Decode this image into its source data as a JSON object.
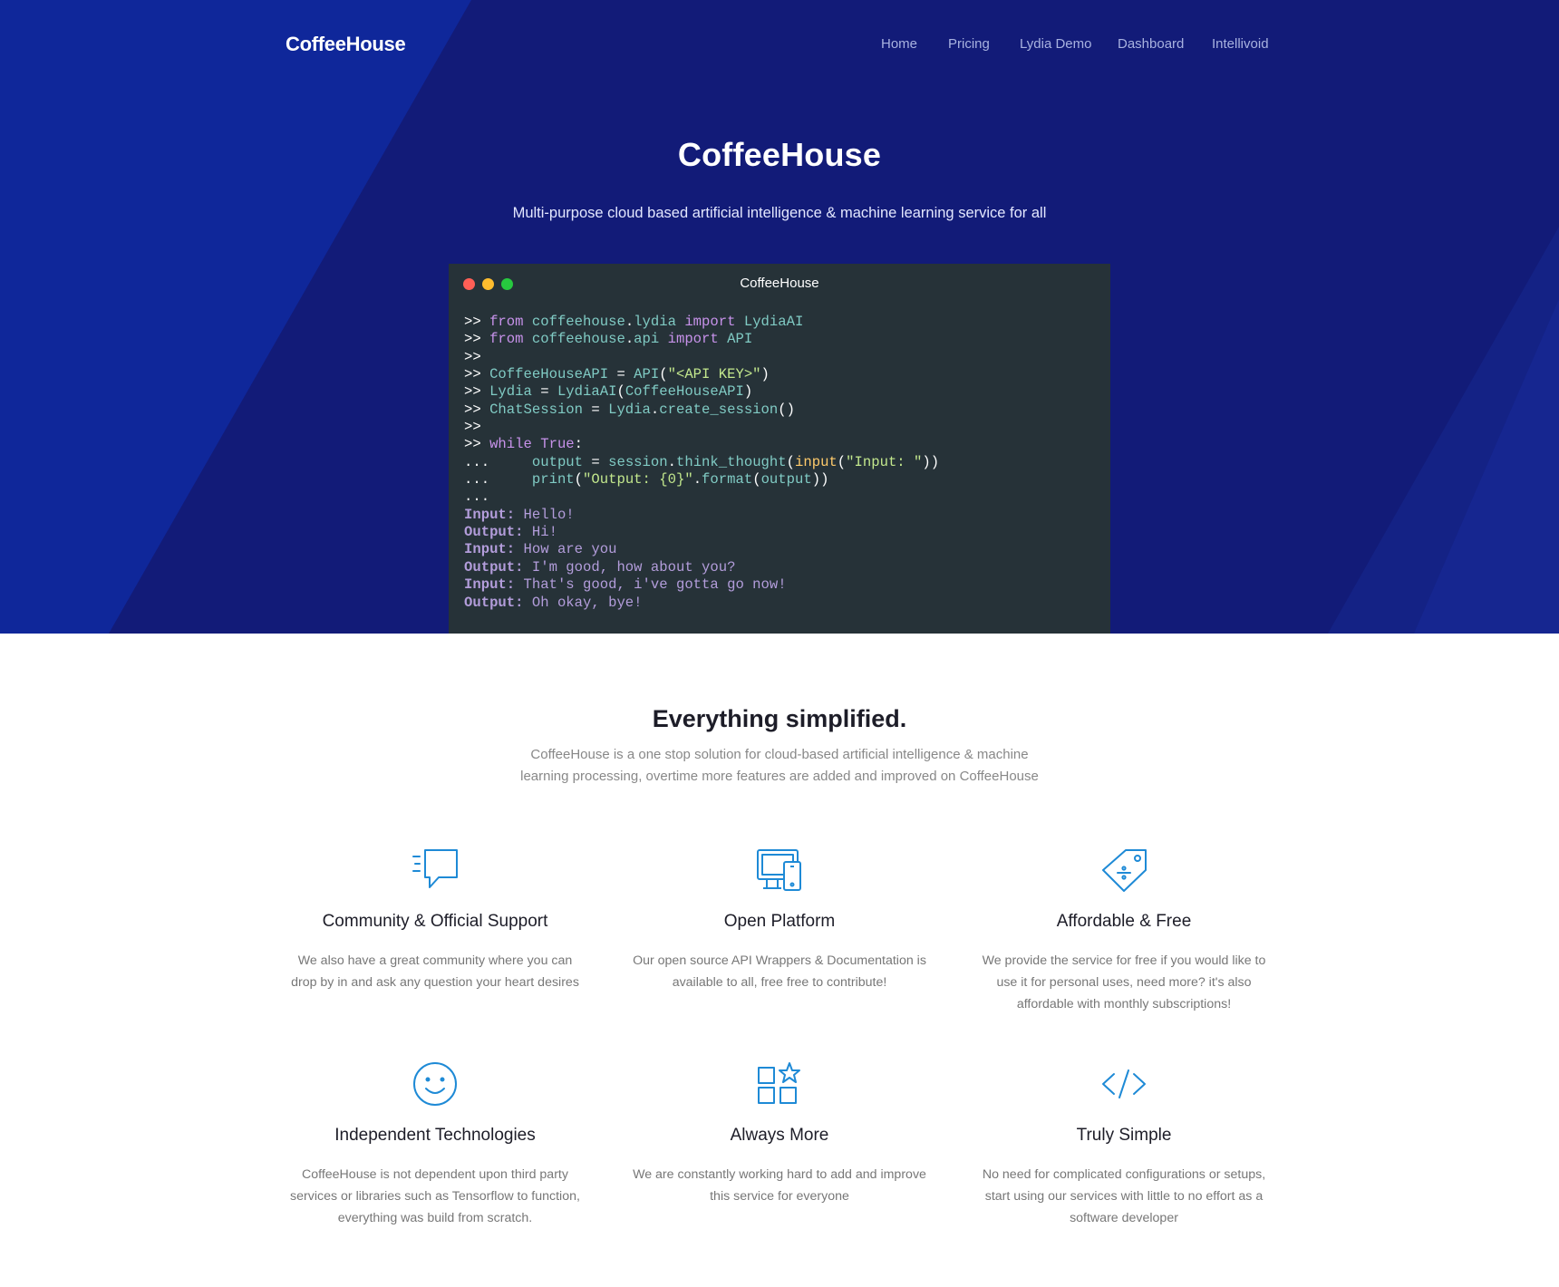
{
  "nav": {
    "brand": "CoffeeHouse",
    "links": [
      "Home",
      "Pricing",
      "Lydia Demo",
      "Dashboard",
      "Intellivoid"
    ]
  },
  "hero": {
    "title": "CoffeeHouse",
    "subtitle": "Multi-purpose cloud based artificial intelligence & machine learning service for all"
  },
  "terminal": {
    "title": "CoffeeHouse",
    "lines": [
      [
        [
          "p",
          ">> "
        ],
        [
          "kw",
          "from "
        ],
        [
          "id",
          "coffeehouse"
        ],
        [
          "p",
          "."
        ],
        [
          "id",
          "lydia "
        ],
        [
          "kw",
          "import "
        ],
        [
          "id",
          "LydiaAI"
        ]
      ],
      [
        [
          "p",
          ">> "
        ],
        [
          "kw",
          "from "
        ],
        [
          "id",
          "coffeehouse"
        ],
        [
          "p",
          "."
        ],
        [
          "id",
          "api "
        ],
        [
          "kw",
          "import "
        ],
        [
          "id",
          "API"
        ]
      ],
      [
        [
          "p",
          ">>"
        ]
      ],
      [
        [
          "p",
          ">> "
        ],
        [
          "id",
          "CoffeeHouseAPI "
        ],
        [
          "p",
          "= "
        ],
        [
          "id",
          "API"
        ],
        [
          "p",
          "("
        ],
        [
          "st",
          "\"<API KEY>\""
        ],
        [
          "p",
          ")"
        ]
      ],
      [
        [
          "p",
          ">> "
        ],
        [
          "id",
          "Lydia "
        ],
        [
          "p",
          "= "
        ],
        [
          "id",
          "LydiaAI"
        ],
        [
          "p",
          "("
        ],
        [
          "id",
          "CoffeeHouseAPI"
        ],
        [
          "p",
          ")"
        ]
      ],
      [
        [
          "p",
          ">> "
        ],
        [
          "id",
          "ChatSession "
        ],
        [
          "p",
          "= "
        ],
        [
          "id",
          "Lydia"
        ],
        [
          "p",
          "."
        ],
        [
          "id",
          "create_session"
        ],
        [
          "p",
          "()"
        ]
      ],
      [
        [
          "p",
          ">>"
        ]
      ],
      [
        [
          "p",
          ">> "
        ],
        [
          "kw",
          "while "
        ],
        [
          "kw",
          "True"
        ],
        [
          "p",
          ":"
        ]
      ],
      [
        [
          "p",
          "...     "
        ],
        [
          "id",
          "output "
        ],
        [
          "p",
          "= "
        ],
        [
          "id",
          "session"
        ],
        [
          "p",
          "."
        ],
        [
          "id",
          "think_thought"
        ],
        [
          "p",
          "("
        ],
        [
          "fnc",
          "input"
        ],
        [
          "p",
          "("
        ],
        [
          "st",
          "\"Input: \""
        ],
        [
          "p",
          "))"
        ]
      ],
      [
        [
          "p",
          "...     "
        ],
        [
          "id",
          "print"
        ],
        [
          "p",
          "("
        ],
        [
          "st",
          "\"Output: {0}\""
        ],
        [
          "p",
          "."
        ],
        [
          "id",
          "format"
        ],
        [
          "p",
          "("
        ],
        [
          "id",
          "output"
        ],
        [
          "p",
          "))"
        ]
      ],
      [
        [
          "p",
          "..."
        ]
      ],
      [
        [
          "lb",
          "Input: "
        ],
        [
          "tx",
          "Hello!"
        ]
      ],
      [
        [
          "lb",
          "Output: "
        ],
        [
          "tx",
          "Hi!"
        ]
      ],
      [
        [
          "lb",
          "Input: "
        ],
        [
          "tx",
          "How are you"
        ]
      ],
      [
        [
          "lb",
          "Output: "
        ],
        [
          "tx",
          "I'm good, how about you?"
        ]
      ],
      [
        [
          "lb",
          "Input: "
        ],
        [
          "tx",
          "That's good, i've gotta go now!"
        ]
      ],
      [
        [
          "lb",
          "Output: "
        ],
        [
          "tx",
          "Oh okay, bye!"
        ]
      ]
    ]
  },
  "section": {
    "title": "Everything simplified.",
    "description": "CoffeeHouse is a one stop solution for cloud-based artificial intelligence & machine learning processing, overtime more features are added and improved on CoffeeHouse"
  },
  "features": [
    {
      "icon": "chat-bubble-icon",
      "title": "Community & Official Support",
      "text": "We also have a great community where you can drop by in and ask any question your heart desires"
    },
    {
      "icon": "devices-icon",
      "title": "Open Platform",
      "text": "Our open source API Wrappers & Documentation is available to all, free free to contribute!"
    },
    {
      "icon": "price-tag-icon",
      "title": "Affordable & Free",
      "text": "We provide the service for free if you would like to use it for personal uses, need more? it's also affordable with monthly subscriptions!"
    },
    {
      "icon": "smiley-icon",
      "title": "Independent Technologies",
      "text": "CoffeeHouse is not dependent upon third party services or libraries such as Tensorflow to function, everything was build from scratch."
    },
    {
      "icon": "grid-star-icon",
      "title": "Always More",
      "text": "We are constantly working hard to add and improve this service for everyone"
    },
    {
      "icon": "code-icon",
      "title": "Truly Simple",
      "text": "No need for complicated configurations or setups, start using our services with little to no effort as a software developer"
    }
  ],
  "colors": {
    "hero_bg": "#121b78",
    "accent_icon": "#1e8ad6",
    "terminal_bg": "#263238"
  }
}
